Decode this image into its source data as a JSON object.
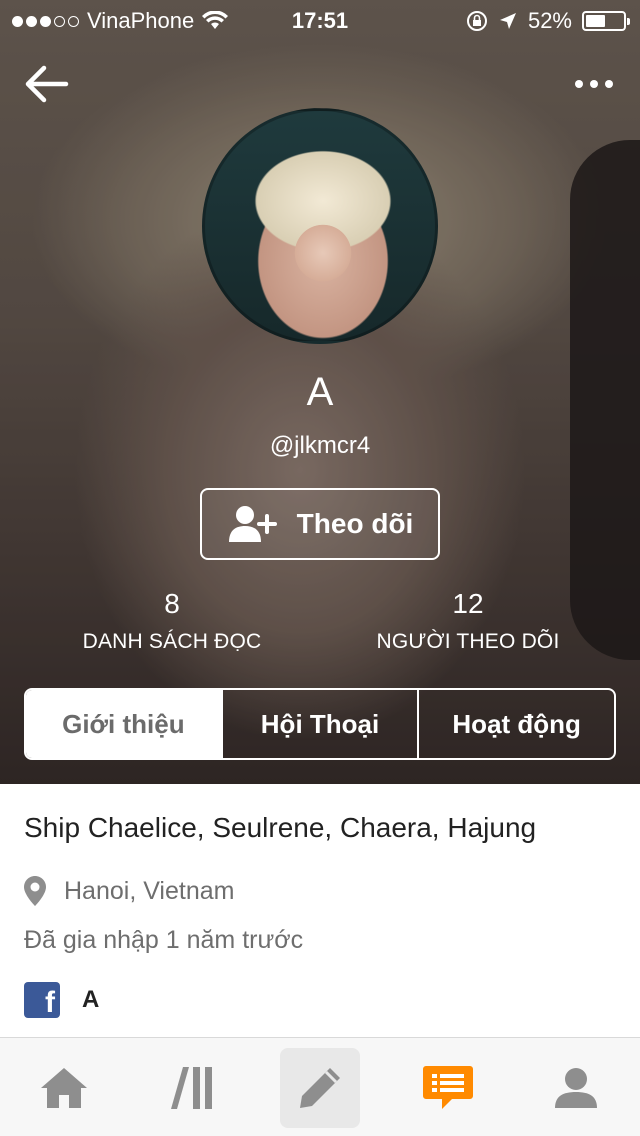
{
  "status_bar": {
    "carrier": "VinaPhone",
    "time": "17:51",
    "battery_percent": "52%",
    "battery_level": 0.52,
    "signal_bars_filled": 3,
    "signal_bars_total": 5
  },
  "profile": {
    "name": "A",
    "username": "@jlkmcr4",
    "follow_label": "Theo dõi",
    "stats": [
      {
        "value": "8",
        "label": "DANH SÁCH ĐỌC"
      },
      {
        "value": "12",
        "label": "NGƯỜI THEO DÕI"
      }
    ]
  },
  "tabs": [
    {
      "label": "Giới thiệu",
      "active": true
    },
    {
      "label": "Hội Thoại",
      "active": false
    },
    {
      "label": "Hoạt động",
      "active": false
    }
  ],
  "about": {
    "bio": "Ship Chaelice, Seulrene, Chaera, Hajung",
    "location": "Hanoi, Vietnam",
    "joined": "Đã gia nhập 1 năm trước",
    "facebook_name": "A"
  },
  "bottom_nav": [
    {
      "icon": "home-icon"
    },
    {
      "icon": "library-icon"
    },
    {
      "icon": "pencil-icon"
    },
    {
      "icon": "messages-icon",
      "color": "#ff8a00"
    },
    {
      "icon": "profile-icon"
    }
  ],
  "colors": {
    "accent": "#ff8a00",
    "facebook": "#3b5998",
    "inactive_icon": "#8e8e8e"
  }
}
